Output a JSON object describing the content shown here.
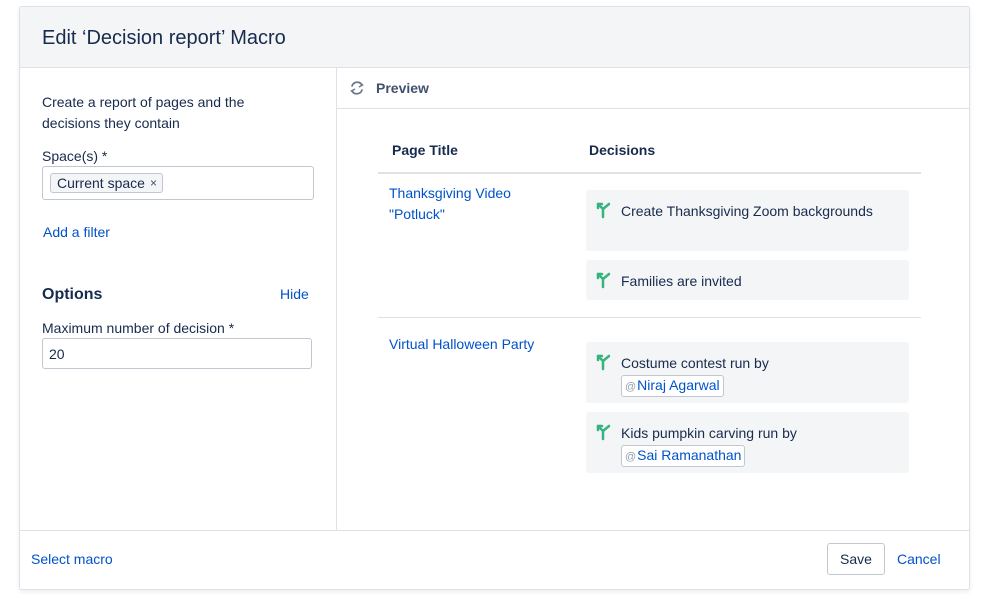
{
  "dialog": {
    "title": "Edit ‘Decision report’ Macro"
  },
  "left_panel": {
    "description": "Create a report of pages and the decisions they contain",
    "spaces_label": "Space(s) *",
    "space_chip": "Current space",
    "space_chip_remove": "×",
    "add_filter": "Add a filter",
    "options_heading": "Options",
    "hide_link": "Hide",
    "max_label": "Maximum number of decision *",
    "max_value": "20"
  },
  "preview": {
    "label": "Preview",
    "columns": [
      "Page Title",
      "Decisions"
    ],
    "rows": [
      {
        "page_title": "Thanksgiving Video \"Potluck\"",
        "decisions": [
          {
            "text": "Create Thanksgiving Zoom backgrounds"
          },
          {
            "text": "Families are invited"
          }
        ]
      },
      {
        "page_title": "Virtual Halloween Party",
        "decisions": [
          {
            "text": "Costume contest run by",
            "mention": "Niraj Agarwal"
          },
          {
            "text": "Kids pumpkin carving run by",
            "mention": "Sai Ramanathan"
          }
        ]
      }
    ],
    "mention_at": "@"
  },
  "footer": {
    "select_macro": "Select macro",
    "save": "Save",
    "cancel": "Cancel"
  },
  "colors": {
    "link": "#0052cc",
    "decision_icon": "#36b37e",
    "card_bg": "#f4f5f7"
  },
  "icons": {
    "preview": "refresh-icon",
    "decision": "decision-icon"
  }
}
